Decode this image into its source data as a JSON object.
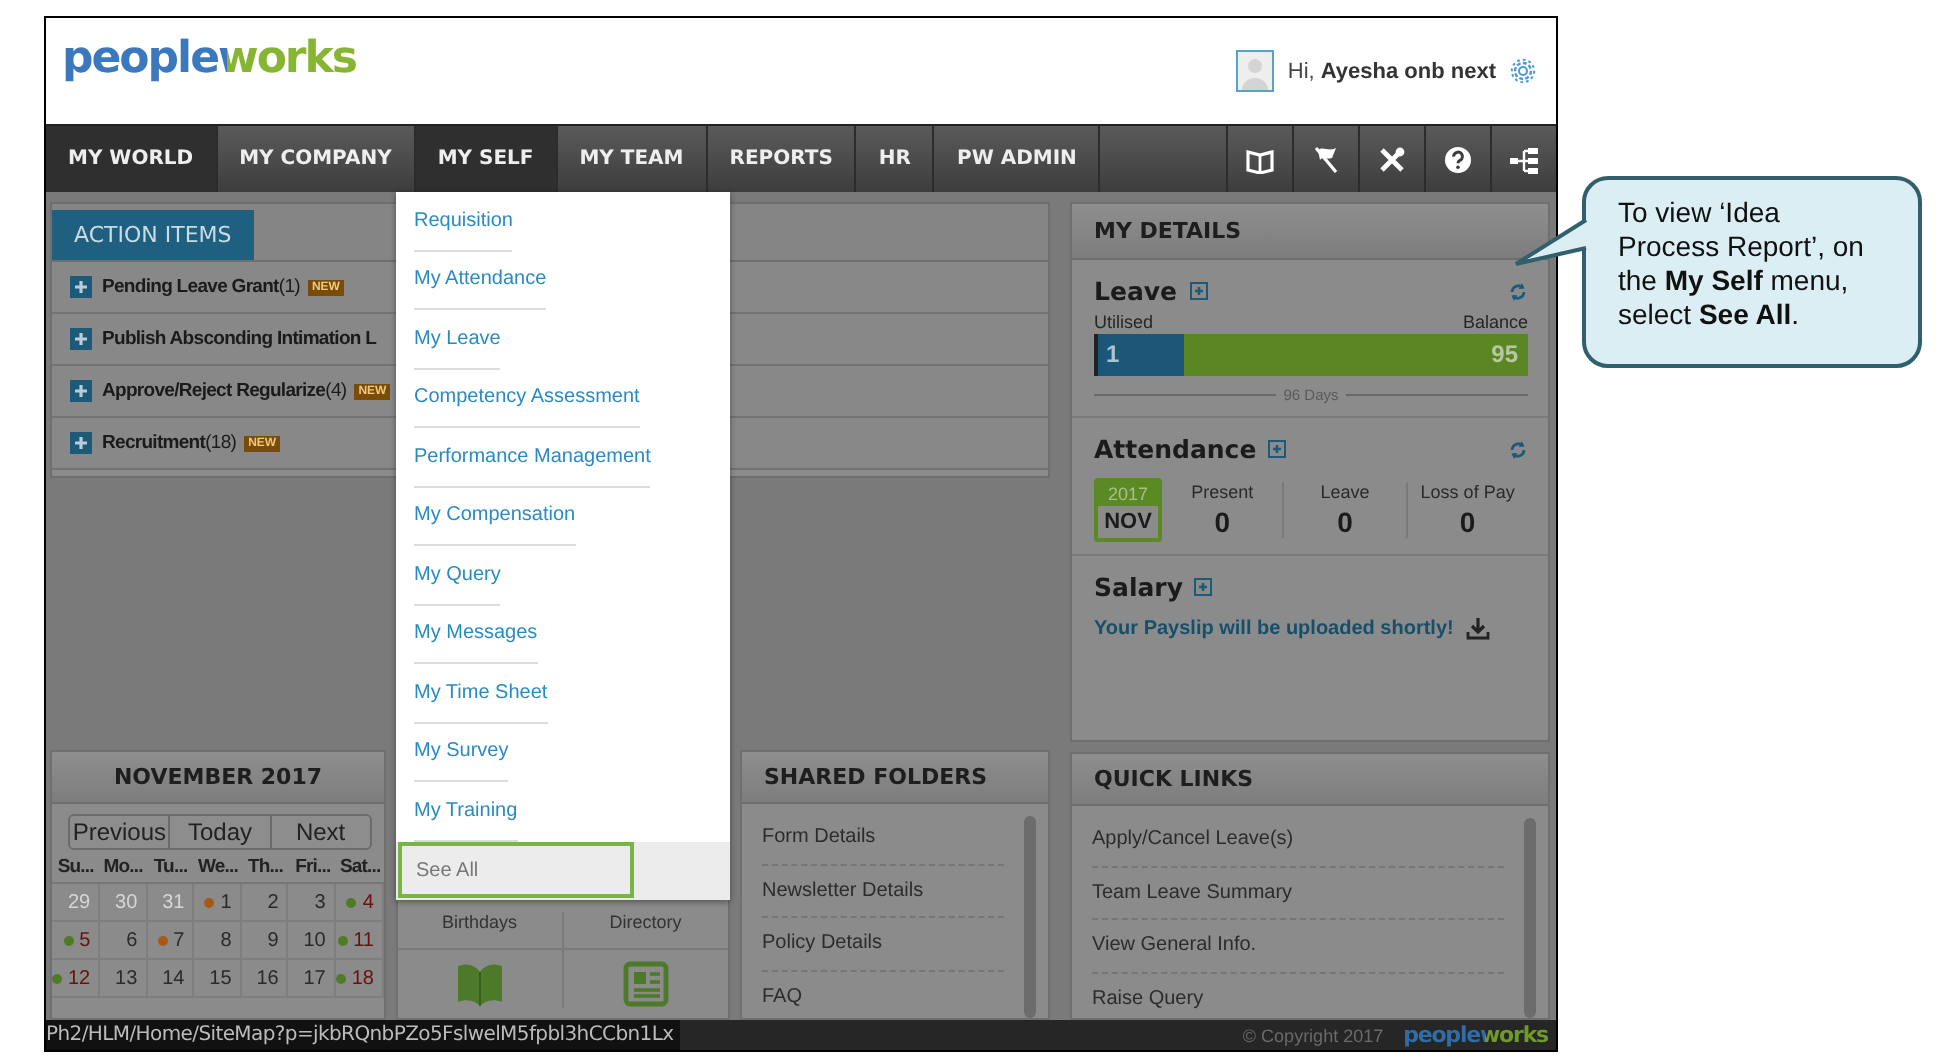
{
  "header": {
    "logo": "peopleworks",
    "greeting": "Hi, **Ayesha onb next**"
  },
  "nav": {
    "tabs": [
      {
        "label": "MY WORLD",
        "selected": true
      },
      {
        "label": "MY COMPANY",
        "selected": false
      },
      {
        "label": "MY SELF",
        "selected": true
      },
      {
        "label": "MY TEAM",
        "selected": false
      },
      {
        "label": "REPORTS",
        "selected": false
      },
      {
        "label": "HR",
        "selected": false
      },
      {
        "label": "PW ADMIN",
        "selected": false
      }
    ]
  },
  "action_items": {
    "tab": "ACTION ITEMS",
    "rows": [
      {
        "text": "**Pending Leave Grant**(1)",
        "badge": "NEW"
      },
      {
        "text": "**Publish Absconding Intimation L**"
      },
      {
        "text": "**Approve/Reject Regularize**(4)",
        "badge": "NEW"
      },
      {
        "text": "**Recruitment**(18)",
        "badge": "NEW"
      }
    ]
  },
  "my_self_menu": {
    "items": [
      {
        "label": "Requisition",
        "highlighted": false
      },
      {
        "label": "My Attendance",
        "highlighted": false
      },
      {
        "label": "My Leave",
        "highlighted": false
      },
      {
        "label": "Competency Assessment",
        "highlighted": false
      },
      {
        "label": "Performance Management",
        "highlighted": false
      },
      {
        "label": "My Compensation",
        "highlighted": false
      },
      {
        "label": "My Query",
        "highlighted": false
      },
      {
        "label": "My Messages",
        "highlighted": false
      },
      {
        "label": "My Time Sheet",
        "highlighted": false
      },
      {
        "label": "My Survey",
        "highlighted": false
      },
      {
        "label": "My Training",
        "highlighted": false
      },
      {
        "label": "See All",
        "highlighted": true
      }
    ]
  },
  "calendar": {
    "title": "NOVEMBER 2017",
    "buttons": [
      "Previous",
      "Today",
      "Next"
    ],
    "weekdays": [
      "Su...",
      "Mo...",
      "Tu...",
      "We...",
      "Th...",
      "Fri...",
      "Sat..."
    ],
    "days": [
      {
        "day": "29",
        "other_month": true,
        "weekend": false
      },
      {
        "day": "30",
        "other_month": true,
        "weekend": false
      },
      {
        "day": "31",
        "other_month": true,
        "weekend": false
      },
      {
        "day": "1",
        "other_month": false,
        "weekend": false,
        "color": "#a85a14"
      },
      {
        "day": "2",
        "other_month": false,
        "weekend": false
      },
      {
        "day": "3",
        "other_month": false,
        "weekend": false
      },
      {
        "day": "4",
        "other_month": false,
        "weekend": true,
        "color": "#4f7a26"
      },
      {
        "day": "5",
        "other_month": false,
        "weekend": true,
        "color": "#4f7a26"
      },
      {
        "day": "6",
        "other_month": false,
        "weekend": false
      },
      {
        "day": "7",
        "other_month": false,
        "weekend": false,
        "color": "#a85a14"
      },
      {
        "day": "8",
        "other_month": false,
        "weekend": false
      },
      {
        "day": "9",
        "other_month": false,
        "weekend": false
      },
      {
        "day": "10",
        "other_month": false,
        "weekend": false
      },
      {
        "day": "11",
        "other_month": false,
        "weekend": true,
        "color": "#4f7a26"
      },
      {
        "day": "12",
        "other_month": false,
        "weekend": true,
        "color": "#4f7a26"
      },
      {
        "day": "13",
        "other_month": false,
        "weekend": false
      },
      {
        "day": "14",
        "other_month": false,
        "weekend": false
      },
      {
        "day": "15",
        "other_month": false,
        "weekend": false
      },
      {
        "day": "16",
        "other_month": false,
        "weekend": false
      },
      {
        "day": "17",
        "other_month": false,
        "weekend": false
      },
      {
        "day": "18",
        "other_month": false,
        "weekend": true,
        "color": "#4f7a26"
      }
    ]
  },
  "widgets": {
    "items": [
      "Birthdays",
      "Directory"
    ]
  },
  "shared_folders": {
    "title": "SHARED FOLDERS",
    "items": [
      "Form Details",
      "Newsletter Details",
      "Policy Details",
      "FAQ"
    ]
  },
  "my_details": {
    "title": "MY DETAILS",
    "leave": {
      "title": "Leave",
      "utilised_label": "Utilised",
      "balance_label": "Balance",
      "utilised": "1",
      "balance": "95",
      "level": 0.2,
      "total": "96 Days"
    },
    "attendance": {
      "title": "Attendance",
      "year": "2017",
      "month": "NOV",
      "stats": [
        {
          "label": "Present",
          "value": "0"
        },
        {
          "label": "Leave",
          "value": "0"
        },
        {
          "label": "Loss of Pay",
          "value": "0"
        }
      ]
    },
    "salary": {
      "title": "Salary",
      "message": "Your Payslip will be uploaded shortly!"
    }
  },
  "quick_links": {
    "title": "QUICK LINKS",
    "items": [
      "Apply/Cancel Leave(s)",
      "Team Leave Summary",
      "View General Info.",
      "Raise Query"
    ]
  },
  "status_bar": {
    "url": "Ph2/HLM/Home/SiteMap?p=jkbRQnbPZo5FslwelM5fpbl3hCCbn1Lx",
    "copyright": "© Copyright 2017",
    "logo": "peopleworks"
  },
  "callout": {
    "text": "To view ‘Idea Process Report’, on the **My Self** menu, select **See All**."
  }
}
